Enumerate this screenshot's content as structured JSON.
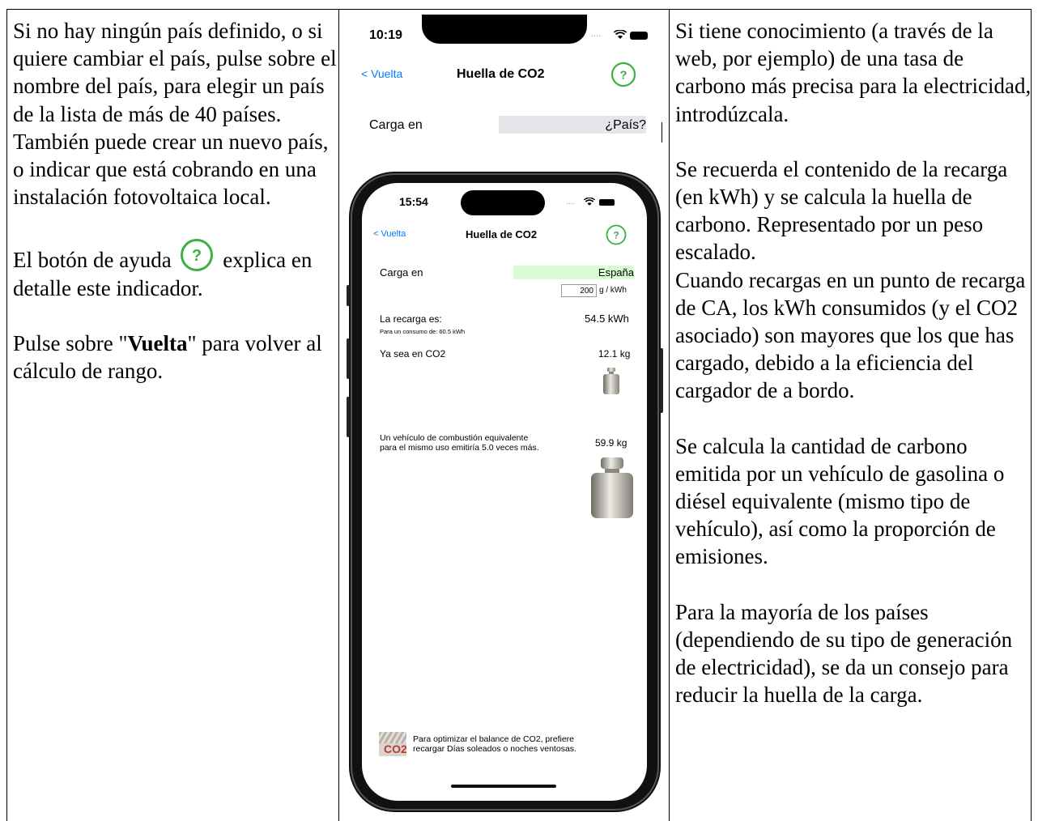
{
  "left_text": {
    "para1": "Si no hay ningún país definido, o si quiere cambiar el país, pulse sobre el nombre del país, para elegir un país de la lista de más de 40 países. También puede crear un nuevo país, o indicar que está cobrando en una instalación fotovoltaica local.",
    "para2_before": "El botón de ayuda",
    "para2_after": "explica en detalle este indicador.",
    "para3_before": "Pulse sobre \"",
    "para3_bold": "Vuelta",
    "para3_after": "\" para volver al cálculo de rango."
  },
  "right_text": {
    "para1": "Si tiene conocimiento (a través de la web, por ejemplo) de una tasa de carbono más precisa para la electricidad, introdúzcala.",
    "para2": "Se recuerda el contenido de la recarga (en kWh) y se calcula la huella de carbono. Representado por un peso escalado.",
    "para3": "Cuando recargas en un punto de recarga de CA, los kWh consumidos (y el CO2 asociado) son mayores que los que has cargado, debido a la eficiencia del cargador de a bordo.",
    "para4": "Se calcula la cantidad de carbono emitida por un vehículo de gasolina o diésel equivalente (mismo tipo de vehículo), así como la proporción de emisiones.",
    "para5": "Para la mayoría de los países (dependiendo de su tipo de generación de electricidad), se da un consejo para reducir la huella de la carga."
  },
  "screen1": {
    "time": "10:19",
    "back": "< Vuelta",
    "title": "Huella de CO2",
    "help": "?",
    "charge_label": "Carga en",
    "country": "¿País?"
  },
  "screen2": {
    "time": "15:54",
    "back": "< Vuelta",
    "title": "Huella de CO2",
    "help": "?",
    "charge_label": "Carga en",
    "country": "España",
    "rate_value": "200",
    "rate_unit": "g / kWh",
    "recharge_label": "La recarga es:",
    "recharge_value": "54.5 kWh",
    "consumption_label": "Para un consumo de:",
    "consumption_value": "60.5 kWh",
    "co2_label": "Ya sea en CO2",
    "co2_value": "12.1 kg",
    "combustion_line1": "Un vehículo de combustión equivalente",
    "combustion_line2": "para el mismo uso emitiría 5.0 veces más.",
    "combustion_value": "59.9 kg",
    "tip_line1": "Para optimizar el balance de CO2, prefiere",
    "tip_line2": "recargar Días soleados o noches ventosas.",
    "tip_icon_text": "CO2"
  },
  "colors": {
    "help_green": "#3cb043",
    "link_blue": "#007aff",
    "country_highlight": "#d9fdd3",
    "field_gray": "#e6e6ea"
  }
}
